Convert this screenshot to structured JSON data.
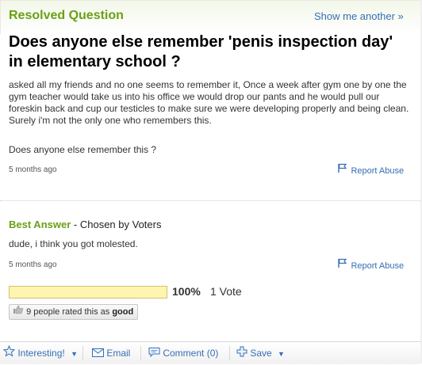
{
  "question": {
    "status_label": "Resolved Question",
    "show_another": "Show me another »",
    "title": "Does anyone else remember 'penis inspection day' in elementary school ?",
    "body": "asked all my friends and no one seems to remember it, Once a week after gym one by one the gym teacher would take us into his office we would drop our pants and he would pull our foreskin back and cup our testicles to make sure we were developing properly and being clean. Surely i'm not the only one who remembers this.",
    "body_followup": "Does anyone else remember this ?",
    "time_ago": "5 months ago",
    "report_label": "Report Abuse"
  },
  "best_answer": {
    "label": "Best Answer",
    "chosen_by": "- Chosen by Voters",
    "text": "dude, i think you got molested.",
    "time_ago": "5 months ago",
    "report_label": "Report Abuse",
    "vote_percent_label": "100%",
    "vote_percent": 1.0,
    "vote_count_label": "1 Vote",
    "rating_text": "9 people rated this as",
    "rating_value": "good"
  },
  "toolbar": {
    "interesting": "Interesting!",
    "email": "Email",
    "comment": "Comment (0)",
    "save": "Save"
  },
  "colors": {
    "accent_green": "#6aa014",
    "link_blue": "#366eb4",
    "vote_bar": "#fdf5b0"
  },
  "icons": [
    "flag-icon",
    "thumbs-up-icon",
    "star-icon",
    "envelope-icon",
    "comment-icon",
    "plus-icon",
    "caret-down-icon"
  ]
}
